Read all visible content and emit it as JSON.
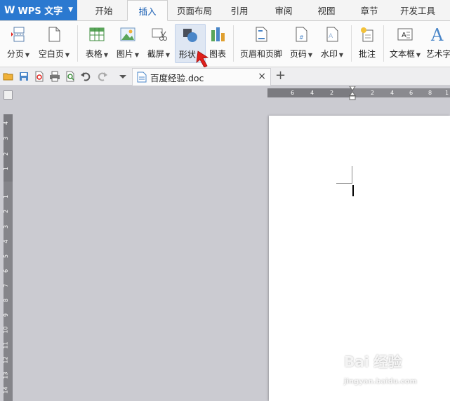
{
  "app": {
    "name": "WPS 文字",
    "logo": "W"
  },
  "menu": {
    "tabs": [
      {
        "label": "开始"
      },
      {
        "label": "插入",
        "active": true
      },
      {
        "label": "页面布局"
      },
      {
        "label": "引用"
      },
      {
        "label": "审阅"
      },
      {
        "label": "视图"
      },
      {
        "label": "章节"
      },
      {
        "label": "开发工具"
      }
    ]
  },
  "ribbon": {
    "buttons": [
      {
        "label": "分页",
        "icon": "page-break-icon",
        "dropdown": true
      },
      {
        "label": "空白页",
        "icon": "blank-page-icon",
        "dropdown": true
      },
      {
        "label": "表格",
        "icon": "table-icon",
        "dropdown": true
      },
      {
        "label": "图片",
        "icon": "picture-icon",
        "dropdown": true
      },
      {
        "label": "截屏",
        "icon": "screenshot-icon",
        "dropdown": true
      },
      {
        "label": "形状",
        "icon": "shapes-icon",
        "dropdown": true,
        "highlighted": true
      },
      {
        "label": "图表",
        "icon": "chart-icon",
        "dropdown": false
      },
      {
        "label": "页眉和页脚",
        "icon": "header-footer-icon",
        "dropdown": false
      },
      {
        "label": "页码",
        "icon": "page-number-icon",
        "dropdown": true
      },
      {
        "label": "水印",
        "icon": "watermark-icon",
        "dropdown": true
      },
      {
        "label": "批注",
        "icon": "comment-icon",
        "dropdown": false
      },
      {
        "label": "文本框",
        "icon": "textbox-icon",
        "dropdown": true
      },
      {
        "label": "艺术字",
        "icon": "wordart-icon",
        "dropdown": false
      }
    ]
  },
  "quick_access": [
    "open-folder-icon",
    "save-icon",
    "export-pdf-icon",
    "print-icon",
    "print-preview-icon",
    "undo-icon",
    "redo-icon",
    "customize-dropdown-icon"
  ],
  "document_tab": {
    "name": "百度经验.doc",
    "close": "×",
    "new_tab": "+"
  },
  "ruler": {
    "horizontal": [
      "6",
      "4",
      "2",
      "2",
      "4",
      "6",
      "8",
      "1"
    ],
    "vertical": [
      "4",
      "3",
      "2",
      "1",
      "1",
      "2",
      "3",
      "4",
      "5",
      "6",
      "7",
      "8",
      "9",
      "10",
      "11",
      "12",
      "13",
      "14"
    ]
  },
  "watermark": {
    "line1": "Bai 经验",
    "line2": "jingyan.baidu.com"
  },
  "colors": {
    "accent": "#2b79d0",
    "active_tab_text": "#1a5fb4",
    "arrow": "#e0201c"
  }
}
